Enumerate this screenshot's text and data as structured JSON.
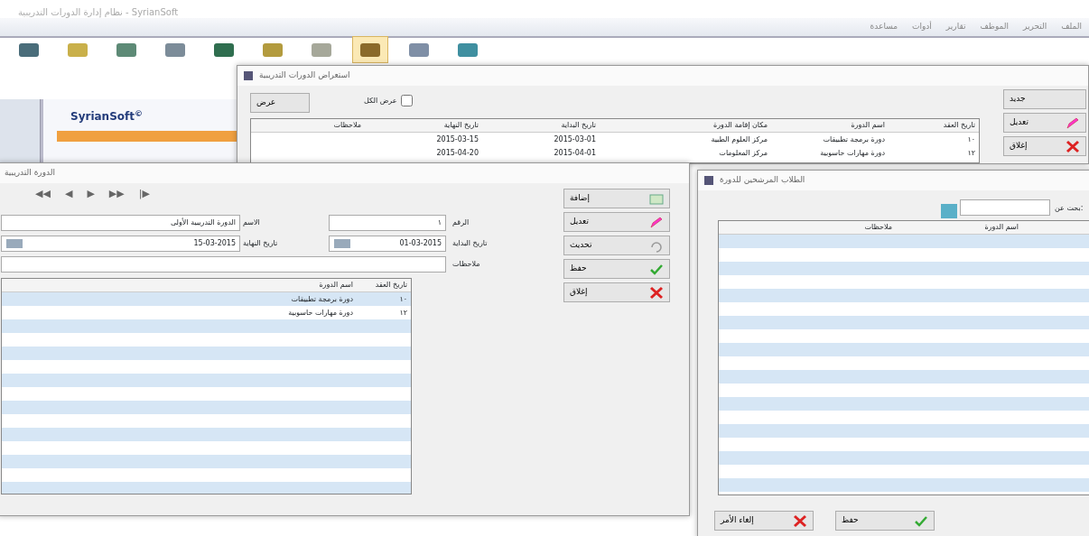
{
  "window": {
    "title": "نظام إدارة الدورات التدريبية - SyrianSoft"
  },
  "menu": [
    "الملف",
    "التحرير",
    "الموظف",
    "تقارير",
    "أدوات",
    "مساعدة"
  ],
  "toolbar": [
    {
      "selected": false
    },
    {
      "selected": false
    },
    {
      "selected": false
    },
    {
      "selected": false
    },
    {
      "selected": false
    },
    {
      "selected": false
    },
    {
      "selected": false
    },
    {
      "selected": true
    },
    {
      "selected": false
    },
    {
      "selected": false
    }
  ],
  "logo_panel": {
    "brand": "SyrianSoft$^{©}$",
    "progress": {
      "level": 1
    }
  },
  "courses_window": {
    "title": "استعراض الدورات التدريبية",
    "show_button": "عرض",
    "show_all": {
      "label": "عرض الكل",
      "checked": false
    },
    "columns": [
      "تاريخ العقد",
      "اسم الدورة",
      "مكان إقامة الدورة",
      "تاريخ البداية",
      "تاريخ النهاية",
      "ملاحظات"
    ],
    "rows": [
      [
        "١٠",
        "دورة برمجة تطبيقات",
        "مركز العلوم الطبية",
        "2015-03-01",
        "2015-03-15",
        ""
      ],
      [
        "١٢",
        "دورة مهارات حاسوبية",
        "مركز المعلومات",
        "2015-04-01",
        "2015-04-20",
        ""
      ]
    ],
    "side_buttons": [
      {
        "label": "جديد",
        "kind": "plain"
      },
      {
        "label": "تعديل",
        "kind": "edit"
      },
      {
        "label": "إغلاق",
        "kind": "close"
      }
    ]
  },
  "course_dialog": {
    "title": "الدورة التدريبية",
    "nav": [
      "▶|",
      "▶▶",
      "▶",
      "◀",
      "◀◀"
    ],
    "number": {
      "label": "الرقم",
      "value": "١"
    },
    "name": {
      "label": "الاسم",
      "value": "الدورة التدريبية الأولى"
    },
    "start": {
      "label": "تاريخ البداية",
      "value": "01-03-2015"
    },
    "end": {
      "label": "تاريخ النهاية",
      "value": "15-03-2015"
    },
    "notes": {
      "label": "ملاحظات"
    },
    "columns": [
      "تاريخ العقد",
      "اسم الدورة"
    ],
    "rows": [
      [
        "١٠",
        "دورة برمجة تطبيقات"
      ],
      [
        "١٢",
        "دورة مهارات حاسوبية"
      ]
    ],
    "buttons": [
      {
        "label": "إضافة",
        "kind": "add"
      },
      {
        "label": "تعديل",
        "kind": "edit"
      },
      {
        "label": "تحديث",
        "kind": "refresh"
      },
      {
        "label": "حفظ",
        "kind": "save"
      },
      {
        "label": "إغلاق",
        "kind": "close"
      }
    ]
  },
  "candidates_dialog": {
    "title": "الطلاب المرشحين للدورة",
    "search_label": "بحث عن:",
    "columns": [
      "اسم الدورة",
      "ملاحظات"
    ],
    "buttons": [
      {
        "label": "حفظ",
        "kind": "save"
      },
      {
        "label": "إلغاء الأمر",
        "kind": "close"
      }
    ]
  }
}
